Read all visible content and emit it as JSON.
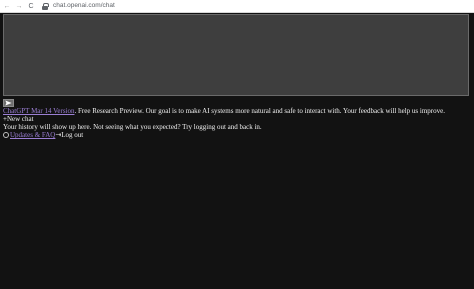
{
  "browser": {
    "url": "chat.openai.com/chat",
    "back_glyph": "←",
    "forward_glyph": "→",
    "reload_glyph": "C"
  },
  "send": {
    "icon": "paper-plane-icon"
  },
  "footer": {
    "version_link": "ChatGPT Mar 14 Version",
    "disclaimer": ". Free Research Preview. Our goal is to make AI systems more natural and safe to interact with. Your feedback will help us improve."
  },
  "sidebar": {
    "new_chat_glyph": "+",
    "new_chat_label": "New chat",
    "history_message": "Your history will show up here. Not seeing what you expected? Try logging out and back in.",
    "updates_link": "Updates & FAQ",
    "logout_glyph": "⇥",
    "logout_label": "Log out"
  },
  "colors": {
    "background": "#121212",
    "input_bg": "#3e3e3e",
    "link": "#9b7fd4"
  }
}
